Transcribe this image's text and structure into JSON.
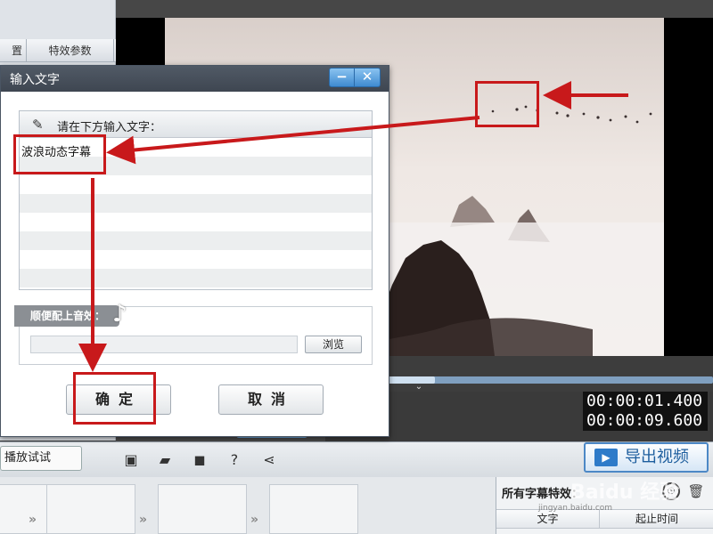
{
  "left_panel": {
    "tab_partial": "置",
    "tab_effects": "特效参数"
  },
  "dialog": {
    "title": "输入文字",
    "minimize_glyph": "−",
    "close_glyph": "✕",
    "prompt": "请在下方输入文字：",
    "entered_text": "波浪动态字幕",
    "music_label": "顺便配上音效：",
    "music_value": "",
    "browse_label": "浏览",
    "ok_label": "确定",
    "cancel_label": "取消"
  },
  "player": {
    "current_time": "00:00:01.400",
    "total_time": "00:00:09.600",
    "progress": 0.1458
  },
  "toolbar": {
    "play_test_label": "播放试试",
    "icons": [
      "new-icon",
      "open-folder-icon",
      "save-icon",
      "help-icon",
      "share-icon"
    ],
    "export_label": "导出视频"
  },
  "subtitle_panel": {
    "title": "所有字幕特效：",
    "col_text": "文字",
    "col_time": "起止时间"
  },
  "watermark": {
    "brand": "Baidu 经验",
    "url": "jingyan.baidu.com"
  },
  "colors": {
    "annotation_red": "#c8191b",
    "accent_blue": "#4c88c6"
  }
}
